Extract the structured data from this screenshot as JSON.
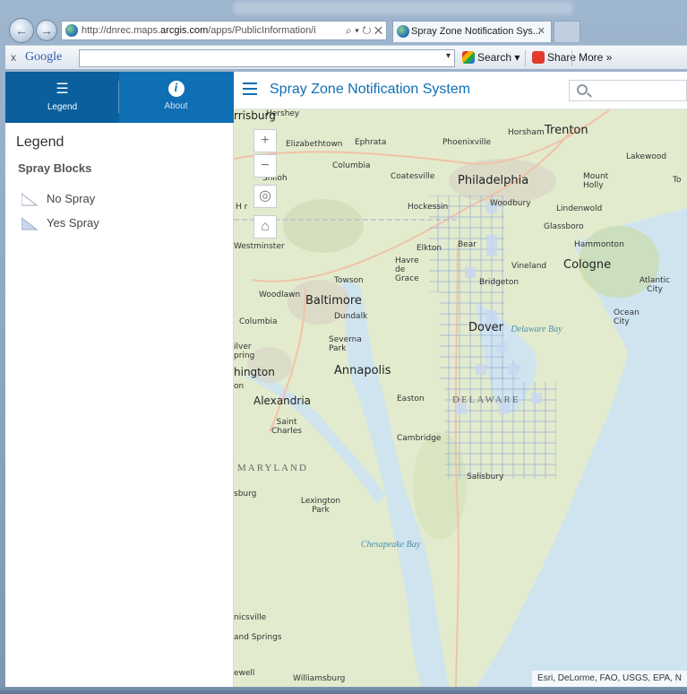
{
  "browser": {
    "address": {
      "prefix": "http://dnrec.maps.",
      "host": "arcgis.com",
      "rest": "/apps/PublicInformation/i"
    },
    "address_tools": "⌕ ▾ ↻ ✕",
    "active_tab": {
      "label": "Spray Zone Notification Sys...",
      "close": "✕"
    }
  },
  "google_toolbar": {
    "close": "x",
    "logo": "Google",
    "search_label": "Search",
    "share_label": "Share",
    "more_label": "More »",
    "dropdown": "▾"
  },
  "sidebar": {
    "tabs": [
      {
        "label": "Legend",
        "icon": "list-icon",
        "glyph": "☰"
      },
      {
        "label": "About",
        "icon": "info-icon",
        "glyph": "i"
      }
    ],
    "legend_title": "Legend",
    "layer_title": "Spray Blocks",
    "items": [
      {
        "label": "No Spray",
        "color": "#ffffff"
      },
      {
        "label": "Yes Spray",
        "color": "#c8d7f3"
      }
    ]
  },
  "header": {
    "title": "Spray Zone Notification System",
    "search_placeholder": ""
  },
  "map": {
    "zoom_in": "+",
    "zoom_out": "−",
    "locate_glyph": "◎",
    "home_glyph": "⌂",
    "labels": {
      "hershey": "Hershey",
      "harrisburg": "rrisburg",
      "trenton": "Trenton",
      "horsham": "Horsham",
      "elizabethtown": "Elizabethtown",
      "ephrata": "Ephrata",
      "phoenixville": "Phoenixville",
      "lakewood": "Lakewood",
      "columbia_pa": "Columbia",
      "coatesville": "Coatesville",
      "philadelphia": "Philadelphia",
      "shiloh": "Shiloh",
      "mount_holly": "Mount Holly",
      "toms": "To",
      "hanover": "H    r",
      "hockessin": "Hockessin",
      "woodbury": "Woodbury",
      "lindenwold": "Lindenwold",
      "glassboro": "Glassboro",
      "hammonton": "Hammonton",
      "westminster": "Westminster",
      "elkton": "Elkton",
      "bear": "Bear",
      "havre": "Havre de Grace",
      "vineland": "Vineland",
      "cologne": "Cologne",
      "atlantic": "Atlantic City",
      "towson": "Towson",
      "bridgeton": "Bridgeton",
      "woodlawn": "Woodlawn",
      "baltimore": "Baltimore",
      "dundalk": "Dundalk",
      "ocean": "Ocean City",
      "columbia_md": "Columbia",
      "dover": "Dover",
      "delaware_bay": "Delaware Bay",
      "silver": "ilver pring",
      "severna": "Severna Park",
      "washington": "hington",
      "annapolis": "Annapolis",
      "on": "on",
      "alexandria": "Alexandria",
      "easton": "Easton",
      "delaware": "DELAWARE",
      "saint": "Saint Charles",
      "cambridge": "Cambridge",
      "maryland": "MARYLAND",
      "salisbury": "Salisbury",
      "fredericksburg": "sburg",
      "lexington": "Lexington Park",
      "chesapeake": "Chesapeake Bay",
      "nicsville": "nicsville",
      "springs": "and Springs",
      "ewell": "ewell",
      "williamsburg": "Williamsburg"
    },
    "attribution": "Esri, DeLorme, FAO, USGS, EPA, N"
  }
}
